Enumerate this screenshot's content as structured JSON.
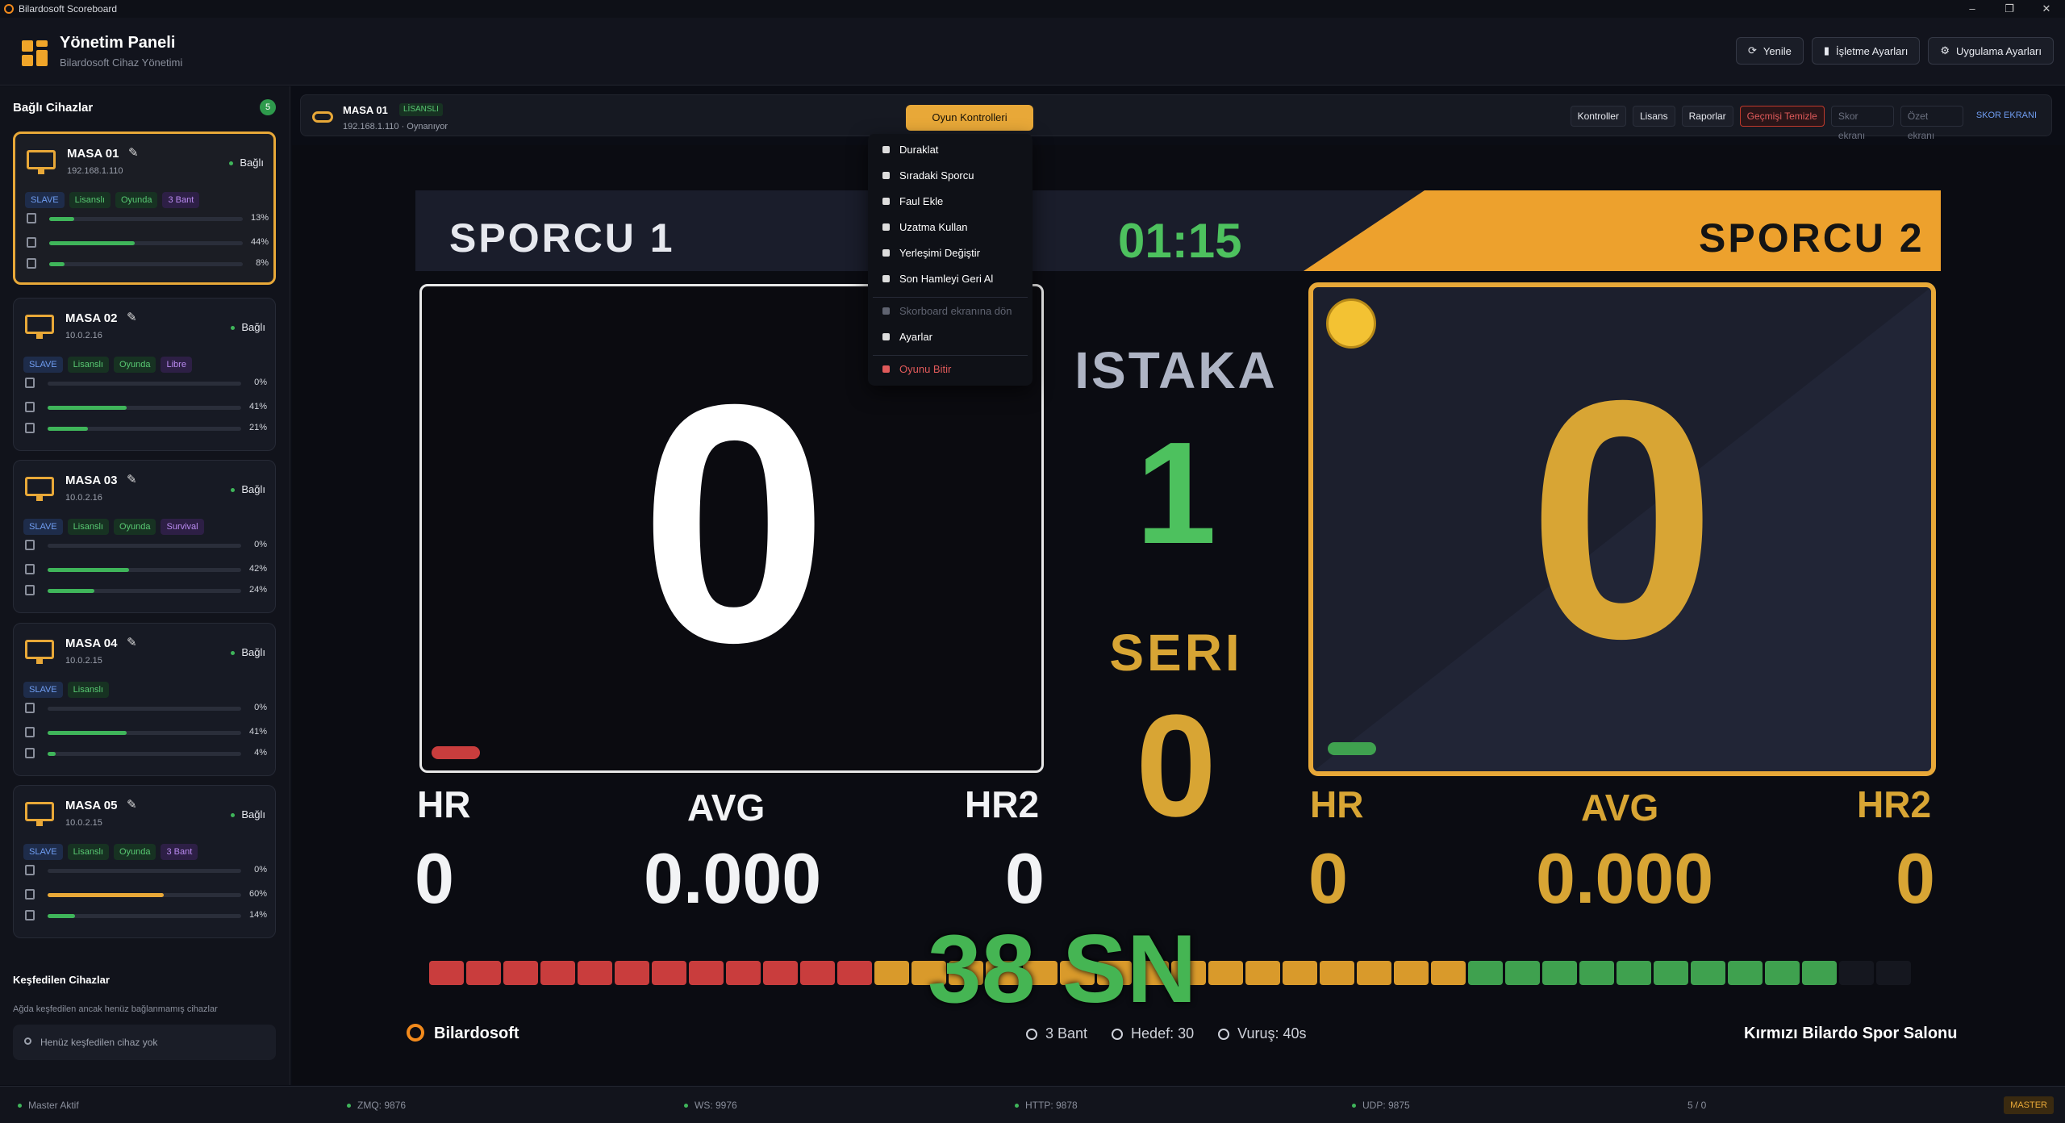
{
  "window": {
    "title": "Bilardosoft Scoreboard",
    "minimize": "–",
    "maximize": "❐",
    "close": "✕"
  },
  "header": {
    "title": "Yönetim Paneli",
    "subtitle": "Bilardosoft Cihaz Yönetimi",
    "buttons": [
      {
        "label": "Yenile",
        "icon": "refresh-icon",
        "glyph": "⟳"
      },
      {
        "label": "İşletme Ayarları",
        "icon": "building-icon",
        "glyph": "▮"
      },
      {
        "label": "Uygulama Ayarları",
        "icon": "gear-icon",
        "glyph": "⚙"
      }
    ]
  },
  "sidebar": {
    "title": "Bağlı Cihazlar",
    "count": "5",
    "devices": [
      {
        "name": "MASA 01",
        "ip": "192.168.1.110",
        "status": "Bağlı",
        "tags": [
          {
            "t": "SLAVE",
            "k": "slave"
          },
          {
            "t": "Lisanslı",
            "k": "lic"
          },
          {
            "t": "Oyunda",
            "k": "game"
          },
          {
            "t": "3 Bant",
            "k": "mode"
          }
        ],
        "meters": [
          {
            "v": 0.13,
            "p": "13%"
          },
          {
            "v": 0.44,
            "p": "44%"
          },
          {
            "v": 0.08,
            "p": "8%"
          }
        ],
        "selected": true
      },
      {
        "name": "MASA 02",
        "ip": "10.0.2.16",
        "status": "Bağlı",
        "tags": [
          {
            "t": "SLAVE",
            "k": "slave"
          },
          {
            "t": "Lisanslı",
            "k": "lic"
          },
          {
            "t": "Oyunda",
            "k": "game"
          },
          {
            "t": "Libre",
            "k": "mode"
          }
        ],
        "meters": [
          {
            "v": 0,
            "p": "0%"
          },
          {
            "v": 0.41,
            "p": "41%"
          },
          {
            "v": 0.21,
            "p": "21%"
          }
        ],
        "selected": false
      },
      {
        "name": "MASA 03",
        "ip": "10.0.2.16",
        "status": "Bağlı",
        "tags": [
          {
            "t": "SLAVE",
            "k": "slave"
          },
          {
            "t": "Lisanslı",
            "k": "lic"
          },
          {
            "t": "Oyunda",
            "k": "game"
          },
          {
            "t": "Survival",
            "k": "mode"
          }
        ],
        "meters": [
          {
            "v": 0,
            "p": "0%"
          },
          {
            "v": 0.42,
            "p": "42%"
          },
          {
            "v": 0.24,
            "p": "24%"
          }
        ],
        "selected": false
      },
      {
        "name": "MASA 04",
        "ip": "10.0.2.15",
        "status": "Bağlı",
        "tags": [
          {
            "t": "SLAVE",
            "k": "slave"
          },
          {
            "t": "Lisanslı",
            "k": "lic"
          }
        ],
        "meters": [
          {
            "v": 0,
            "p": "0%"
          },
          {
            "v": 0.41,
            "p": "41%"
          },
          {
            "v": 0.04,
            "p": "4%"
          }
        ],
        "selected": false
      },
      {
        "name": "MASA 05",
        "ip": "10.0.2.15",
        "status": "Bağlı",
        "tags": [
          {
            "t": "SLAVE",
            "k": "slave"
          },
          {
            "t": "Lisanslı",
            "k": "lic"
          },
          {
            "t": "Oyunda",
            "k": "game"
          },
          {
            "t": "3 Bant",
            "k": "mode"
          }
        ],
        "meters": [
          {
            "v": 0,
            "p": "0%"
          },
          {
            "v": 0.6,
            "p": "60%",
            "yellow": true
          },
          {
            "v": 0.14,
            "p": "14%"
          }
        ],
        "selected": false
      }
    ],
    "discovered_title": "Keşfedilen Cihazlar",
    "discovered_sub": "Ağda keşfedilen ancak henüz bağlanmamış cihazlar",
    "discovered_empty": "Henüz keşfedilen cihaz yok"
  },
  "topbar": {
    "name": "MASA 01",
    "license": "LİSANSLI",
    "ip_status": "192.168.1.110 · Oynanıyor",
    "game_controls": "Oyun Kontrolleri",
    "buttons": [
      "Kontroller",
      "Lisans",
      "Raporlar"
    ],
    "clear": "Geçmişi Temizle",
    "input1": "Skor ekranı",
    "input2": "Özet ekranı",
    "skor_link": "SKOR EKRANI"
  },
  "menu": {
    "items": [
      "Duraklat",
      "Sıradaki Sporcu",
      "Faul Ekle",
      "Uzatma Kullan",
      "Yerleşimi Değiştir",
      "Son Hamleyi Geri Al"
    ],
    "disabled": "Skorboard ekranına dön",
    "settings": "Ayarlar",
    "end": "Oyunu Bitir"
  },
  "scoreboard": {
    "player1": "SPORCU 1",
    "player2": "SPORCU 2",
    "timer": "01:15",
    "score1": "0",
    "score2": "0",
    "istaka_label": "ISTAKA",
    "istaka_value": "1",
    "seri_label": "SERI",
    "seri_value": "0",
    "p1_stats": {
      "hr_label": "HR",
      "hr": "0",
      "avg_label": "AVG",
      "avg": "0.000",
      "hr2_label": "HR2",
      "hr2": "0"
    },
    "p2_stats": {
      "hr_label": "HR",
      "hr": "0",
      "avg_label": "AVG",
      "avg": "0.000",
      "hr2_label": "HR2",
      "hr2": "0"
    },
    "shot_clock": "38 SN",
    "timeline": {
      "red": 12,
      "orange": 16,
      "green": 10,
      "empty": 2
    },
    "brand": "Bilardosoft",
    "mode": "3 Bant",
    "target": "Hedef: 30",
    "shot_time": "Vuruş: 40s",
    "venue": "Kırmızı Bilardo Spor Salonu"
  },
  "statusbar": {
    "master": "Master Aktif",
    "zmq": "ZMQ: 9876",
    "ws": "WS: 9976",
    "http": "HTTP: 9878",
    "udp": "UDP: 9875",
    "devices": "5 / 0",
    "role": "MASTER"
  },
  "colors": {
    "accent": "#e8a838",
    "green": "#4dc15e",
    "red": "#c93d3d",
    "orange": "#eda12d"
  }
}
